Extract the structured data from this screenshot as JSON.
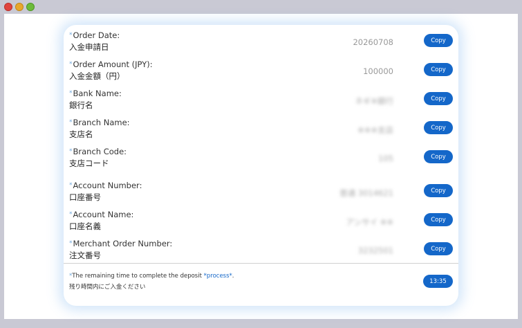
{
  "window": {
    "controls": [
      "close",
      "minimize",
      "zoom"
    ]
  },
  "card": {
    "copy_label": "Copy",
    "rows": [
      {
        "label_en": "Order Date:",
        "label_ja": "入金申請日",
        "value": "20260708",
        "blurred": false
      },
      {
        "label_en": "Order Amount (JPY):",
        "label_ja": "入金金額（円）",
        "value": "100000",
        "blurred": false
      },
      {
        "label_en": "Bank Name:",
        "label_ja": "銀行名",
        "value": "ネギ※銀行",
        "blurred": true
      },
      {
        "label_en": "Branch Name:",
        "label_ja": "支店名",
        "value": "※※※支店",
        "blurred": true
      },
      {
        "label_en": "Branch Code:",
        "label_ja": "支店コード",
        "value": "105",
        "blurred": true
      },
      {
        "label_en": "Account Number:",
        "label_ja": "口座番号",
        "value": "普通 3014621",
        "blurred": true
      },
      {
        "label_en": "Account Name:",
        "label_ja": "口座名義",
        "value": "アンサイ ※※",
        "blurred": true
      },
      {
        "label_en": "Merchant Order Number:",
        "label_ja": "注文番号",
        "value": "3232501",
        "blurred": true
      }
    ],
    "footer": {
      "asterisk": "*",
      "text_en_prefix": "The remaining time to complete the deposit ",
      "text_en_process": "*process*",
      "text_en_suffix": ".",
      "text_ja": "残り時間内にご入金ください",
      "timer": "13:35"
    }
  }
}
